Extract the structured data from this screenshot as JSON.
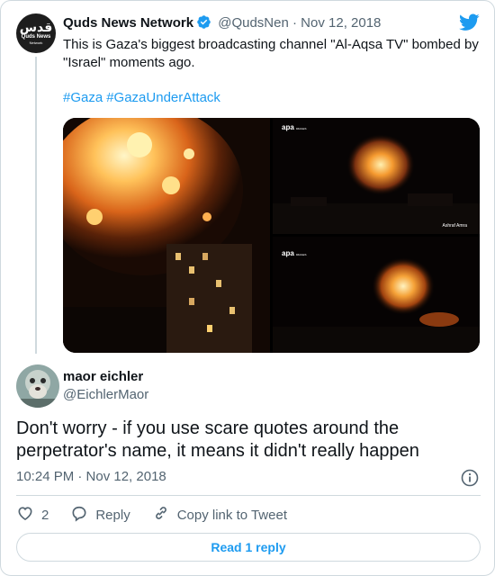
{
  "parent_tweet": {
    "avatar": {
      "text_ar": "قدس",
      "text_en": "Quds News",
      "text_sub": "Network"
    },
    "author_name": "Quds News Network",
    "author_handle": "@QudsNen",
    "separator": "·",
    "date": "Nov 12, 2018",
    "text": "This is Gaza's biggest broadcasting channel \"Al-Aqsa TV\" bombed by \"Israel\" moments ago.",
    "hashtags": [
      "#Gaza",
      "#GazaUnderAttack"
    ],
    "media": {
      "watermark": "apa",
      "watermark_sub": "IMAGES",
      "credit": "Ashraf Amra"
    }
  },
  "reply": {
    "author_name": "maor eichler",
    "author_handle": "@EichlerMaor",
    "text": "Don't worry - if you use scare quotes around the perpetrator's name, it means it didn't really happen",
    "time": "10:24 PM · Nov 12, 2018",
    "actions": {
      "like_count": "2",
      "reply_label": "Reply",
      "copy_label": "Copy link to Tweet"
    },
    "read_replies_label": "Read 1 reply"
  },
  "colors": {
    "accent": "#1d9bf0",
    "text": "#0f1419",
    "muted": "#536471",
    "border": "#cfd9de"
  }
}
